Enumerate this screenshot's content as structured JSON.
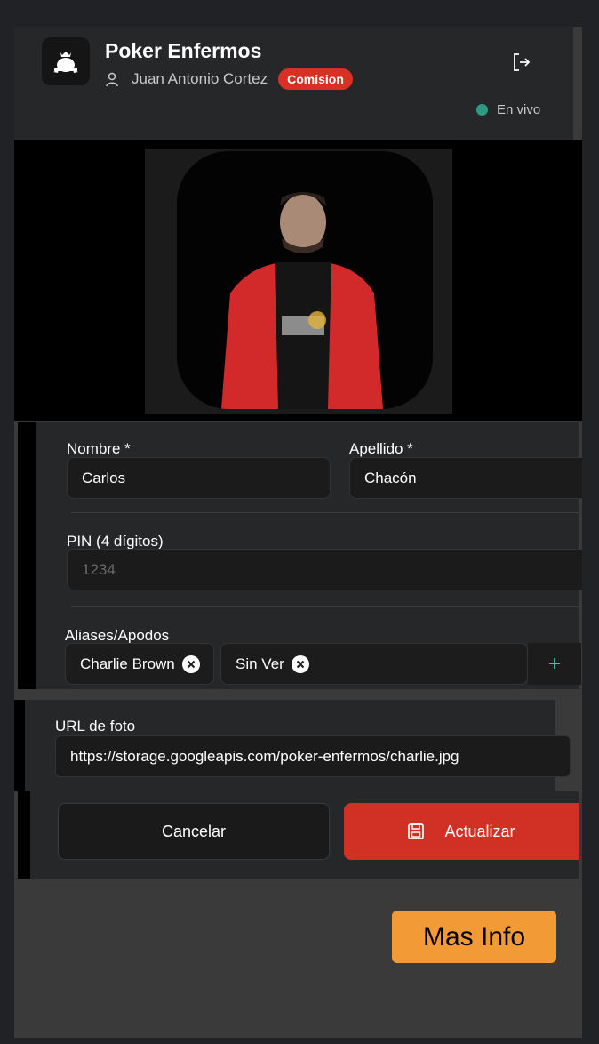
{
  "header": {
    "title": "Poker Enfermos",
    "user_name": "Juan Antonio Cortez",
    "role_badge": "Comision",
    "live_status": "En vivo",
    "icons": {
      "logo": "poker-crown-logo-icon",
      "user": "user-icon",
      "logout": "logout-icon"
    }
  },
  "colors": {
    "accent_red": "#d13124",
    "live_green": "#2d9a82",
    "plus_teal": "#3fc7a6",
    "more_info_orange": "#f29a35"
  },
  "form": {
    "nombre_label": "Nombre *",
    "nombre_value": "Carlos",
    "apellido_label": "Apellido *",
    "apellido_value": "Chacón",
    "pin_label": "PIN (4 dígitos)",
    "pin_placeholder": "1234",
    "aliases_label": "Aliases/Apodos",
    "aliases": [
      "Charlie Brown",
      "Sin Ver"
    ],
    "add_alias_symbol": "+",
    "url_label": "URL de foto",
    "url_value": "https://storage.googleapis.com/poker-enfermos/charlie.jpg"
  },
  "actions": {
    "cancel_label": "Cancelar",
    "update_label": "Actualizar"
  },
  "more_info_label": "Mas Info"
}
